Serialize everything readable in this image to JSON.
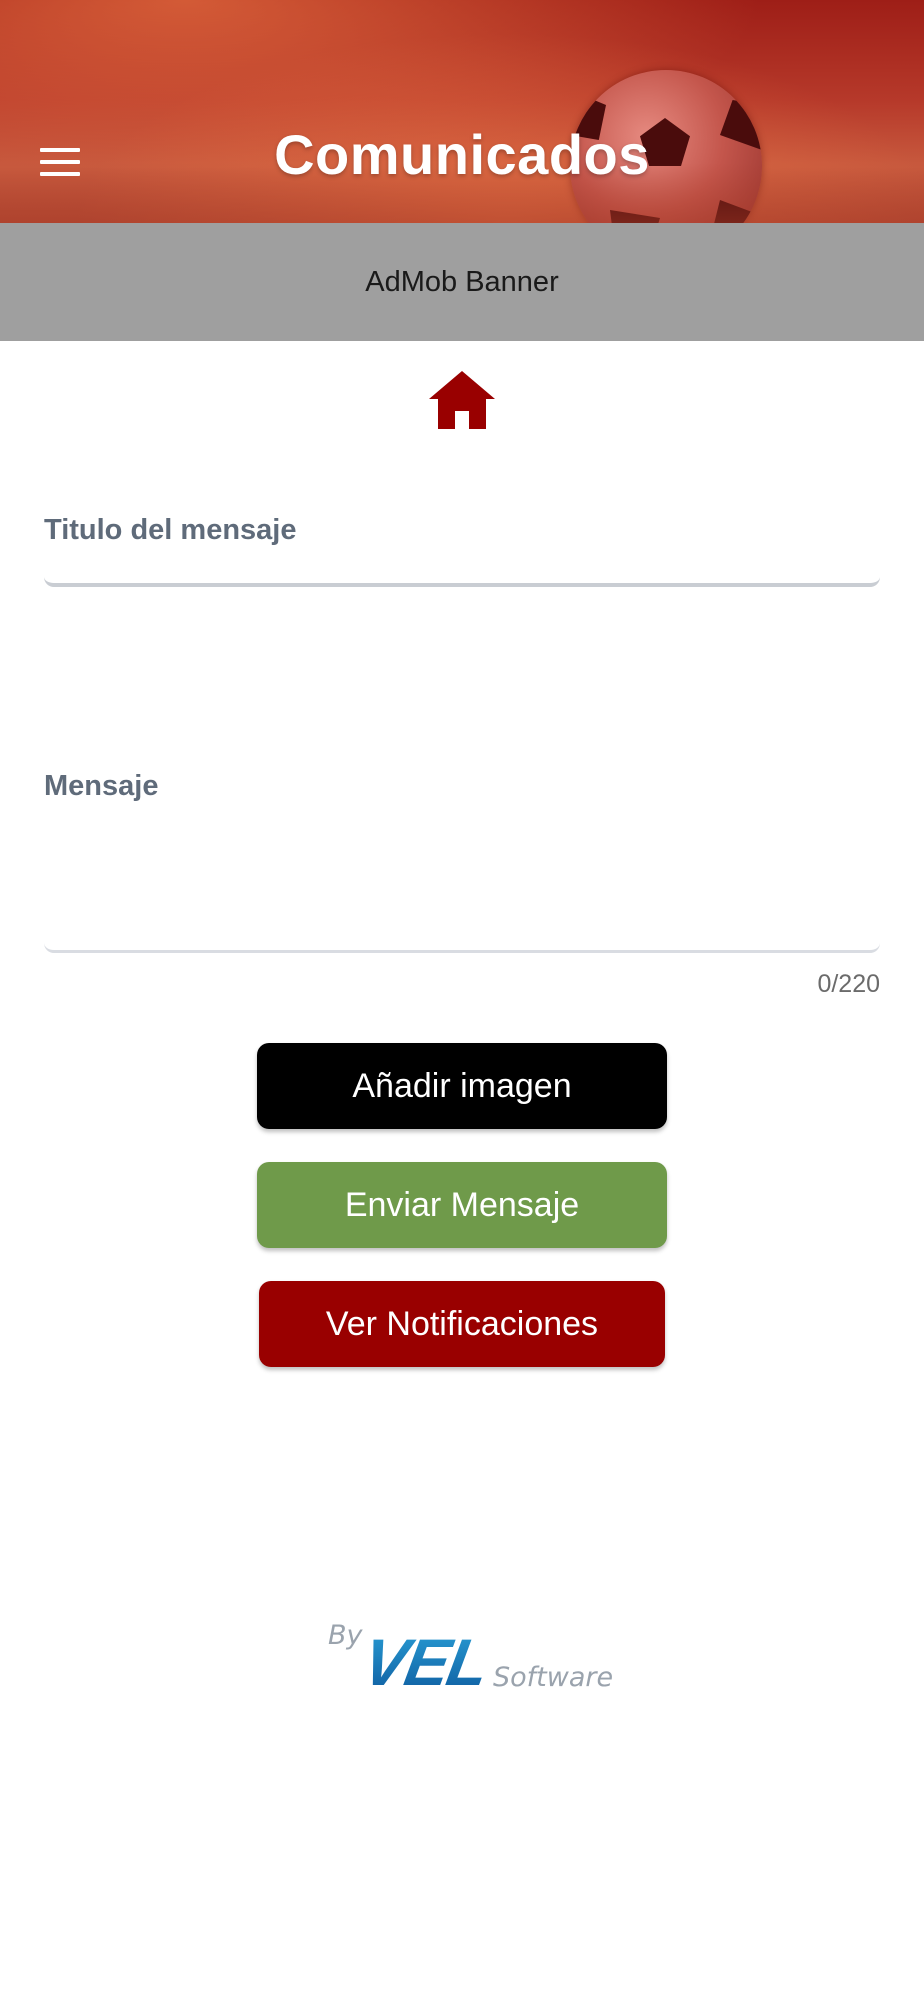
{
  "header": {
    "title": "Comunicados",
    "menu_icon": "hamburger-menu-icon",
    "background_image": "soccer-ball-on-field"
  },
  "ad_banner": {
    "label": "AdMob Banner"
  },
  "home": {
    "icon": "home-icon",
    "color": "#990000"
  },
  "form": {
    "title_field": {
      "label": "Titulo del mensaje",
      "value": ""
    },
    "message_field": {
      "label": "Mensaje",
      "value": "",
      "counter": "0/220"
    }
  },
  "buttons": {
    "add_image": "Añadir imagen",
    "send_message": "Enviar Mensaje",
    "view_notifications": "Ver Notificaciones"
  },
  "colors": {
    "add_image_bg": "#000000",
    "send_message_bg": "#6f9a4a",
    "view_notifications_bg": "#990000"
  },
  "footer": {
    "by": "By",
    "brand": "VEL",
    "brand_suffix": "Software"
  }
}
